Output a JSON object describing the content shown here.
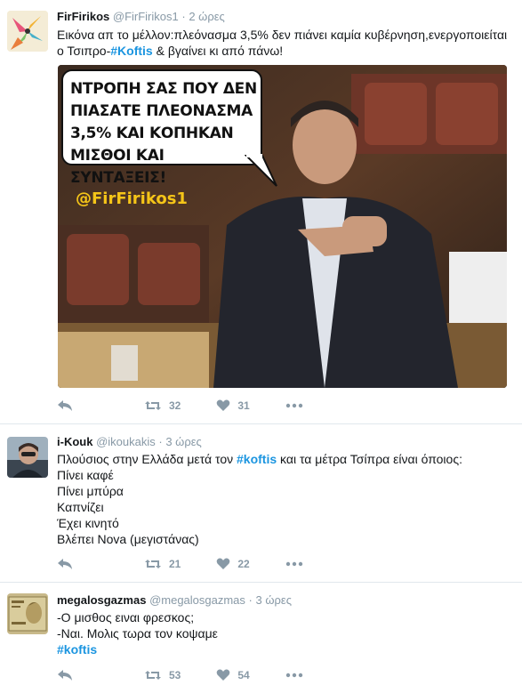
{
  "colors": {
    "link": "#1b95e0",
    "meta": "#8899a6",
    "text": "#14171a"
  },
  "tweets": [
    {
      "name": "FirFirikos",
      "handle": "@FirFirikos1",
      "dot": "·",
      "time": "2 ώρες",
      "text_a": "Εικόνα απ το μέλλον:πλεόνασμα 3,5% δεν πιάνει καμία κυβέρνηση,ενεργοποιείται ο Τσιπρο-",
      "hashtag": "#Koftis",
      "text_b": " & βγαίνει κι από πάνω!",
      "image": {
        "bubble_lines": [
          "ΝΤΡΟΠΗ ΣΑΣ ΠΟΥ ΔΕΝ",
          "ΠΙΑΣΑΤΕ ΠΛΕΟΝΑΣΜΑ",
          "3,5% ΚΑΙ ΚΟΠΗΚΑΝ",
          "ΜΙΣΘΟΙ ΚΑΙ ΣΥΝΤΑΞΕΙΣ!"
        ],
        "watermark": "@FirFirikos1"
      },
      "retweets": "32",
      "likes": "31"
    },
    {
      "name": "i-Kouk",
      "handle": "@ikoukakis",
      "dot": "·",
      "time": "3 ώρες",
      "text_a": "Πλούσιος στην Ελλάδα μετά τον ",
      "hashtag": "#koftis",
      "text_b": " και τα μέτρα Τσίπρα είναι όποιος:",
      "lines": [
        "Πίνει καφέ",
        "Πίνει μπύρα",
        "Καπνίζει",
        "Έχει κινητό",
        "Βλέπει Nova (μεγιστάνας)"
      ],
      "retweets": "21",
      "likes": "22"
    },
    {
      "name": "megalosgazmas",
      "handle": "@megalosgazmas",
      "dot": "·",
      "time": "3 ώρες",
      "lines": [
        "-Ο μισθος ειναι φρεσκος;",
        "-Ναι. Μολις τωρα τον κοψαμε"
      ],
      "hashtag": "#koftis",
      "retweets": "53",
      "likes": "54"
    }
  ],
  "icons": {
    "reply": "reply-icon",
    "retweet": "retweet-icon",
    "like": "heart-icon",
    "more": "more-icon"
  }
}
